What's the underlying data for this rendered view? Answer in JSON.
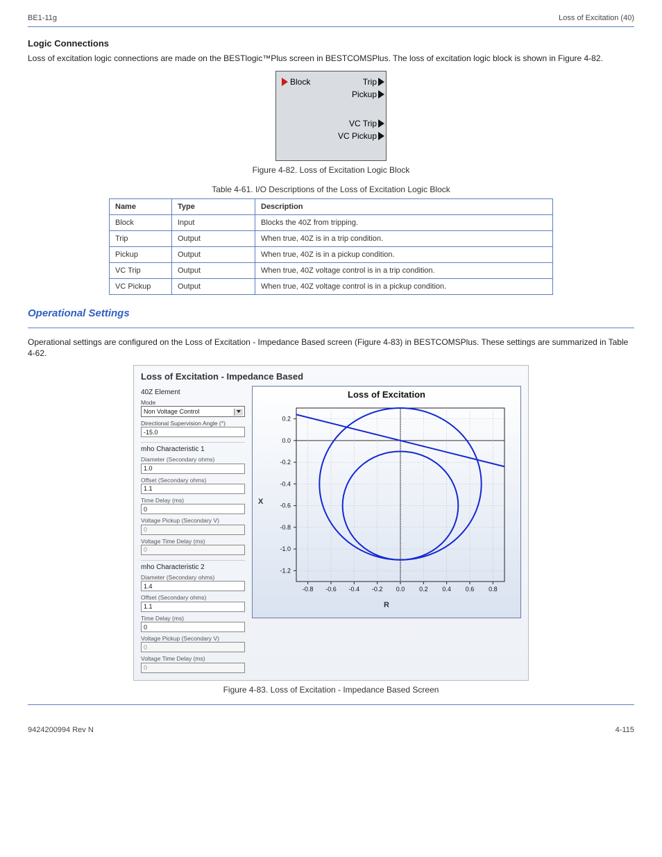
{
  "page_header": {
    "left": "BE1-11g",
    "right": "Loss of Excitation (40)"
  },
  "logic_block": {
    "section_title": "Logic Connections",
    "intro": "Loss of excitation logic connections are made on the BESTlogic™Plus screen in BESTCOMSPlus. The loss of excitation logic block is shown in Figure 4-82.",
    "left_input": "Block",
    "right_outputs": [
      "Trip",
      "Pickup",
      "VC Trip",
      "VC Pickup"
    ],
    "figure_caption": "Figure 4-82. Loss of Excitation Logic Block"
  },
  "io_table": {
    "caption": "Table 4-61. I/O Descriptions of the Loss of Excitation Logic Block",
    "columns": [
      "Name",
      "Type",
      "Description"
    ],
    "rows": [
      [
        "Block",
        "Input",
        "Blocks the 40Z from tripping."
      ],
      [
        "Trip",
        "Output",
        "When true, 40Z is in a trip condition."
      ],
      [
        "Pickup",
        "Output",
        "When true, 40Z is in a pickup condition."
      ],
      [
        "VC Trip",
        "Output",
        "When true, 40Z voltage control is in a trip condition."
      ],
      [
        "VC Pickup",
        "Output",
        "When true, 40Z voltage control is in a pickup condition."
      ]
    ]
  },
  "operational_settings": {
    "heading": "Operational Settings",
    "para": "Operational settings are configured on the Loss of Excitation - Impedance Based screen (Figure 4-83) in BESTCOMSPlus. These settings are summarized in Table 4-62.",
    "panel_title": "Loss of Excitation - Impedance Based",
    "group_label": "40Z Element",
    "mode_label": "Mode",
    "mode_value": "Non Voltage Control",
    "dir_angle_label": "Directional Supervision Angle (°)",
    "dir_angle_value": "-15.0",
    "mho1_title": "mho Characteristic 1",
    "mho2_title": "mho Characteristic 2",
    "diameter_label": "Diameter (Secondary ohms)",
    "offset_label": "Offset (Secondary ohms)",
    "time_delay_label": "Time Delay (ms)",
    "voltage_pickup_label": "Voltage Pickup (Secondary V)",
    "voltage_td_label": "Voltage Time Delay (ms)",
    "mho1": {
      "diameter": "1.0",
      "offset": "1.1",
      "time_delay": "0",
      "voltage_pickup": "0",
      "voltage_td": "0"
    },
    "mho2": {
      "diameter": "1.4",
      "offset": "1.1",
      "time_delay": "0",
      "voltage_pickup": "0",
      "voltage_td": "0"
    },
    "chart_title": "Loss of Excitation",
    "x_axis_label": "R",
    "y_axis_label": "X",
    "figure_caption": "Figure 4-83. Loss of Excitation - Impedance Based Screen"
  },
  "chart_data": {
    "type": "line",
    "title": "Loss of Excitation",
    "xlabel": "R",
    "ylabel": "X",
    "xlim": [
      -0.9,
      0.9
    ],
    "ylim": [
      -1.3,
      0.3
    ],
    "x_ticks": [
      -0.8,
      -0.6,
      -0.4,
      -0.2,
      0.0,
      0.2,
      0.4,
      0.6,
      0.8
    ],
    "y_ticks": [
      0.2,
      0.0,
      -0.2,
      -0.4,
      -0.6,
      -0.8,
      -1.0,
      -1.2
    ],
    "series": [
      {
        "name": "mho1",
        "shape": "circle",
        "center": [
          0,
          -0.6
        ],
        "radius": 0.5
      },
      {
        "name": "mho2",
        "shape": "circle",
        "center": [
          0,
          -0.4
        ],
        "radius": 0.7
      },
      {
        "name": "directional",
        "shape": "line",
        "points": [
          [
            -0.9,
            0.24
          ],
          [
            0.9,
            -0.24
          ]
        ]
      }
    ]
  },
  "footer": {
    "left": "9424200994 Rev N",
    "right": "4-115"
  }
}
